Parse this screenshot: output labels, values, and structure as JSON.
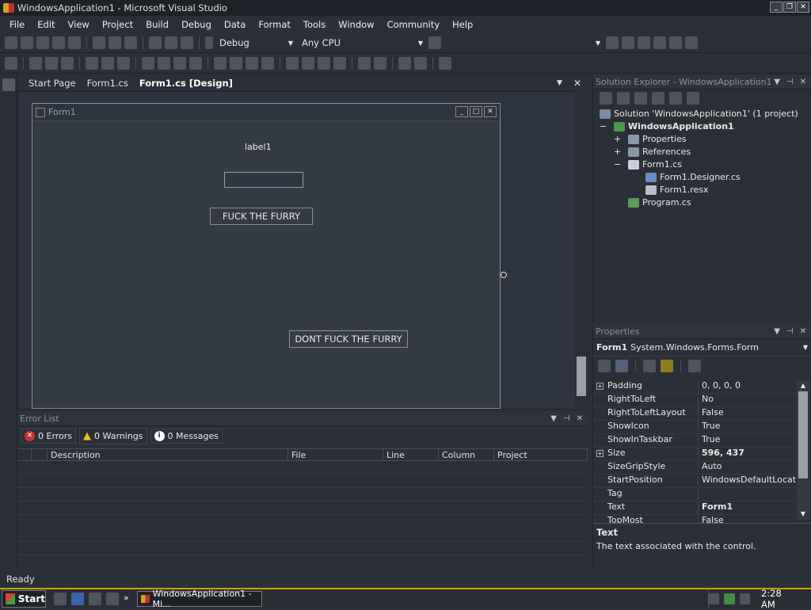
{
  "window": {
    "title": "WindowsApplication1 - Microsoft Visual Studio",
    "controls": [
      "_",
      "❐",
      "✕"
    ]
  },
  "menu": [
    "File",
    "Edit",
    "View",
    "Project",
    "Build",
    "Debug",
    "Data",
    "Format",
    "Tools",
    "Window",
    "Community",
    "Help"
  ],
  "toolbar": {
    "config": "Debug",
    "platform": "Any CPU"
  },
  "doc_tabs": [
    {
      "label": "Start Page"
    },
    {
      "label": "Form1.cs"
    },
    {
      "label": "Form1.cs [Design]"
    }
  ],
  "form": {
    "title": "Form1",
    "label1": "label1",
    "button1": "FUCK THE FURRY",
    "button2": "DONT FUCK THE FURRY"
  },
  "error_list": {
    "title": "Error List",
    "errors": "0 Errors",
    "warnings": "0 Warnings",
    "messages": "0 Messages",
    "columns": [
      "Description",
      "File",
      "Line",
      "Column",
      "Project"
    ]
  },
  "solution_explorer": {
    "title": "Solution Explorer - WindowsApplication1",
    "solution": "Solution 'WindowsApplication1' (1 project)",
    "project": "WindowsApplication1",
    "items": [
      "Properties",
      "References",
      "Form1.cs",
      "Form1.Designer.cs",
      "Form1.resx",
      "Program.cs"
    ]
  },
  "properties": {
    "title": "Properties",
    "object_name": "Form1",
    "object_type": "System.Windows.Forms.Form",
    "rows": [
      {
        "name": "Padding",
        "value": "0, 0, 0, 0",
        "expandable": true
      },
      {
        "name": "RightToLeft",
        "value": "No"
      },
      {
        "name": "RightToLeftLayout",
        "value": "False"
      },
      {
        "name": "ShowIcon",
        "value": "True"
      },
      {
        "name": "ShowInTaskbar",
        "value": "True"
      },
      {
        "name": "Size",
        "value": "596, 437",
        "expandable": true,
        "bold": true
      },
      {
        "name": "SizeGripStyle",
        "value": "Auto"
      },
      {
        "name": "StartPosition",
        "value": "WindowsDefaultLocation"
      },
      {
        "name": "Tag",
        "value": ""
      },
      {
        "name": "Text",
        "value": "Form1",
        "bold": true
      },
      {
        "name": "TopMost",
        "value": "False"
      }
    ],
    "desc_title": "Text",
    "desc_text": "The text associated with the control."
  },
  "status": "Ready",
  "taskbar": {
    "start": "Start",
    "task": "WindowsApplication1 - Mi...",
    "clock": "2:28 AM"
  }
}
